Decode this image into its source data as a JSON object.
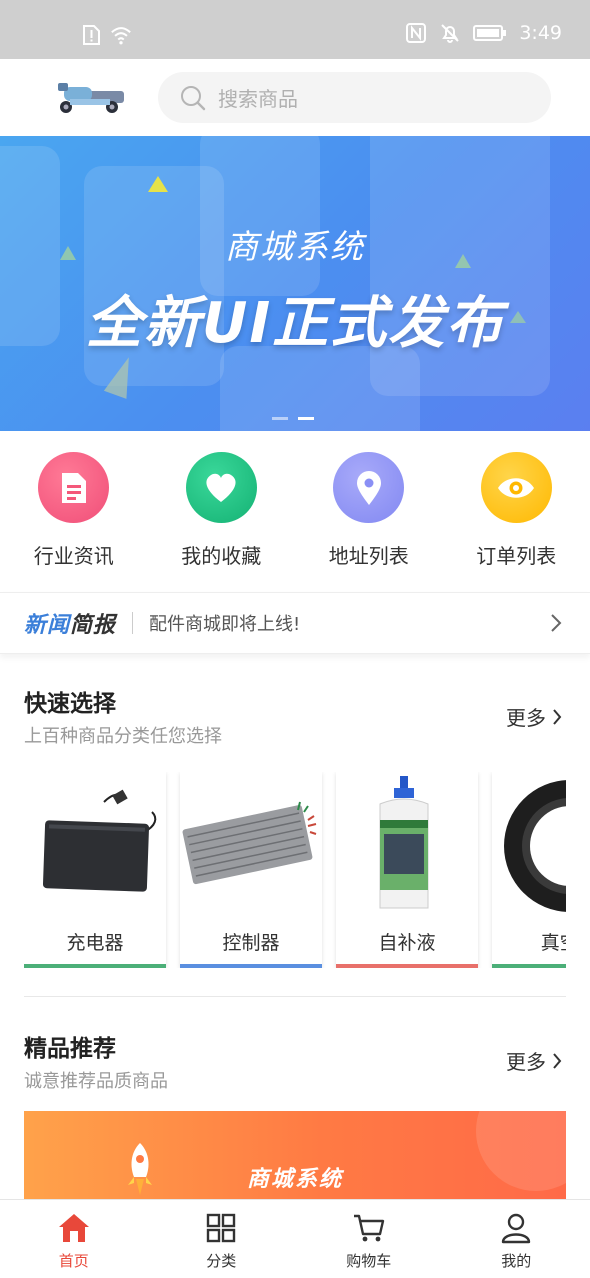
{
  "status_bar": {
    "time": "3:49"
  },
  "search": {
    "placeholder": "搜索商品"
  },
  "banner": {
    "subtitle": "商城系统",
    "title": "全新UI正式发布"
  },
  "quick_nav": [
    {
      "label": "行业资讯",
      "icon": "document-icon",
      "color": "#f4587a"
    },
    {
      "label": "我的收藏",
      "icon": "heart-icon",
      "color": "#22c083"
    },
    {
      "label": "地址列表",
      "icon": "location-pin-icon",
      "color": "#8a8ff5"
    },
    {
      "label": "订单列表",
      "icon": "eye-icon",
      "color": "#ffc11a"
    }
  ],
  "news": {
    "logo_a": "新闻",
    "logo_b": "简报",
    "text": "配件商城即将上线!"
  },
  "quick_select": {
    "title": "快速选择",
    "subtitle": "上百种商品分类任您选择",
    "more": "更多",
    "categories": [
      {
        "label": "充电器",
        "bar_color": "#4caf78"
      },
      {
        "label": "控制器",
        "bar_color": "#5a8fe0"
      },
      {
        "label": "自补液",
        "bar_color": "#e8706a"
      },
      {
        "label": "真空:",
        "bar_color": "#4caf78"
      }
    ]
  },
  "featured": {
    "title": "精品推荐",
    "subtitle": "诚意推荐品质商品",
    "more": "更多",
    "banner_text": "商城系统"
  },
  "tab_bar": [
    {
      "label": "首页",
      "icon": "home-icon",
      "active": true
    },
    {
      "label": "分类",
      "icon": "grid-icon",
      "active": false
    },
    {
      "label": "购物车",
      "icon": "cart-icon",
      "active": false
    },
    {
      "label": "我的",
      "icon": "user-icon",
      "active": false
    }
  ],
  "colors": {
    "accent": "#e8483a",
    "news_blue": "#3b7fd9"
  }
}
